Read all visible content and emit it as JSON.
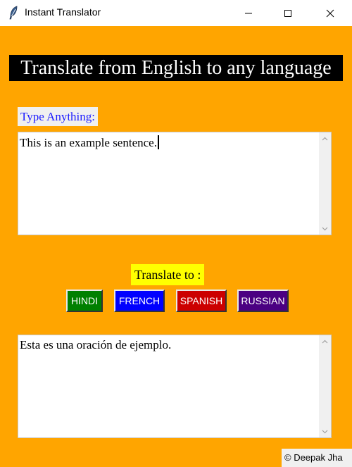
{
  "window": {
    "title": "Instant Translator",
    "icon": "feather-icon"
  },
  "app": {
    "headline": "Translate from English to any language",
    "input": {
      "label": "Type Anything:",
      "value": "This is an example sentence."
    },
    "translate_label": "Translate to :",
    "languages": [
      {
        "label": "HINDI",
        "color": "#008000"
      },
      {
        "label": "FRENCH",
        "color": "#0000ff"
      },
      {
        "label": "SPANISH",
        "color": "#cc0000"
      },
      {
        "label": "RUSSIAN",
        "color": "#4b0082"
      }
    ],
    "output": {
      "value": "Esta es una oración de ejemplo."
    },
    "credit": "© Deepak Jha"
  },
  "colors": {
    "background": "#ffa500",
    "headline_bg": "#000000",
    "headline_text": "#ffffff",
    "label_text": "#1a1aff",
    "translate_label_bg": "#ffff00"
  }
}
